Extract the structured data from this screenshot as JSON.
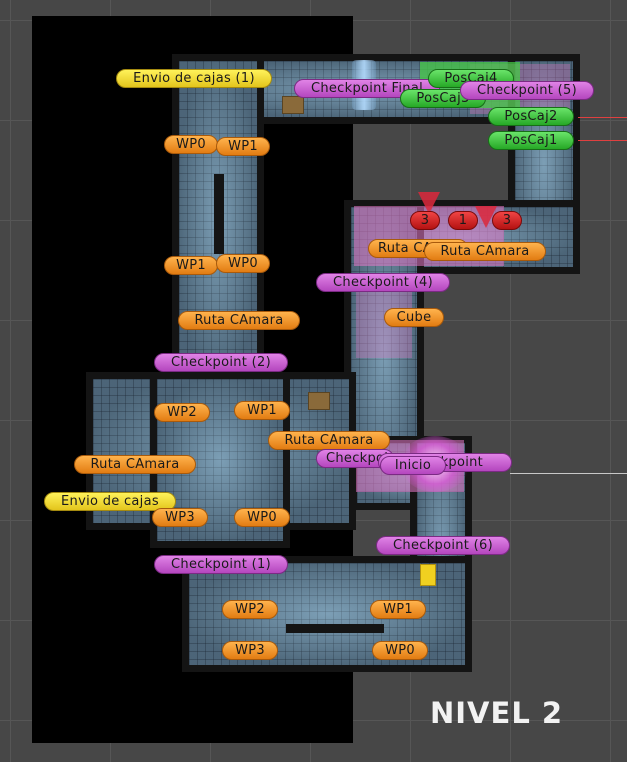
{
  "scene": {
    "level_title": "NIVEL 2",
    "markers": {
      "envio_cajas_1": "Envio de cajas (1)",
      "envio_cajas": "Envio de cajas",
      "checkpoint_final": "Checkpoint Final",
      "checkpoint_5": "Checkpoint (5)",
      "checkpoint_4": "Checkpoint (4)",
      "checkpoint_2": "Checkpoint (2)",
      "checkpoint_1": "Checkpoint (1)",
      "checkpoint_6": "Checkpoint (6)",
      "checkpoint_mid": "Checkpoint",
      "poscaj4": "PosCaj4",
      "poscaj3": "PosCaj3",
      "poscaj2": "PosCaj2",
      "poscaj1": "PosCaj1",
      "ruta_camara": "Ruta CAmara",
      "cube": "Cube",
      "inicio": "Inicio",
      "wp0": "WP0",
      "wp1": "WP1",
      "wp2": "WP2",
      "wp3": "WP3",
      "num3": "3",
      "num1": "1"
    },
    "colors": {
      "waypoint": "#f39a2a",
      "checkpoint": "#c85ad0",
      "envio": "#f6dc2a",
      "poscaj": "#3ccc3c",
      "camera_count": "#d42020"
    }
  }
}
